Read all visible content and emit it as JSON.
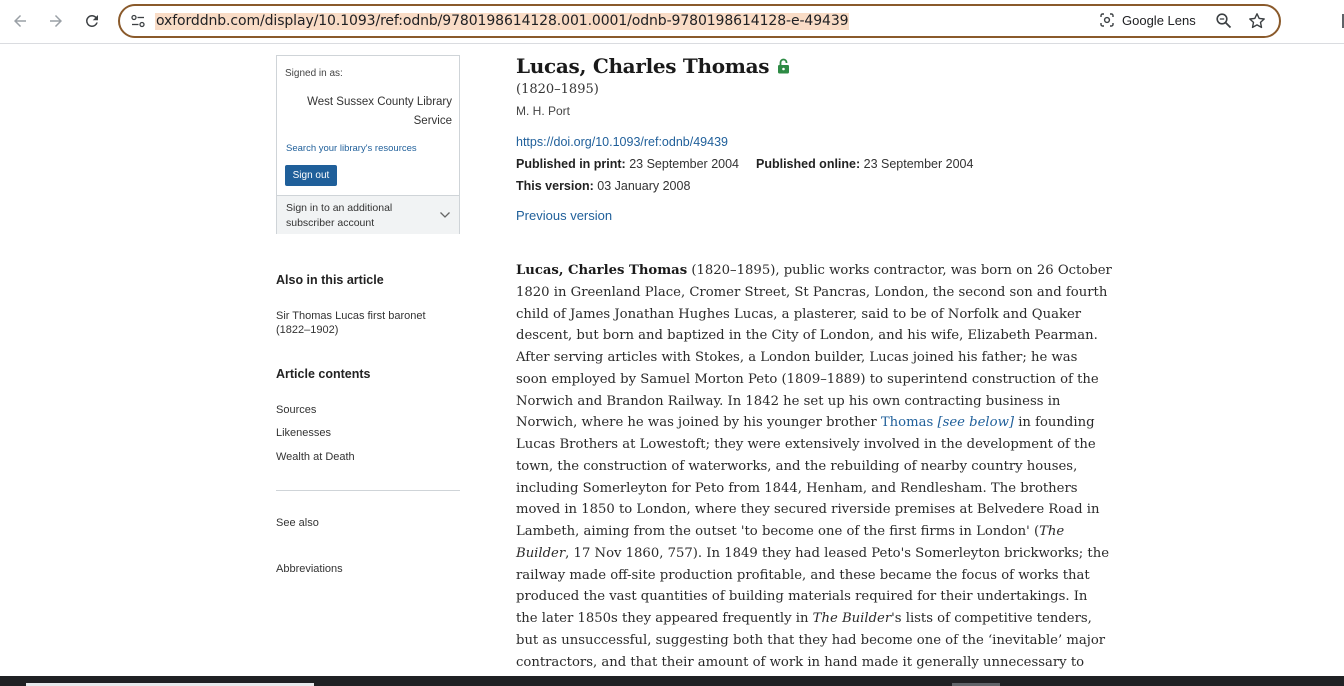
{
  "browser": {
    "url": "oxforddnb.com/display/10.1093/ref:odnb/9780198614128.001.0001/odnb-9780198614128-e-49439",
    "lens_label": "Google Lens",
    "icons": [
      "back-arrow-icon",
      "forward-arrow-icon",
      "reload-icon",
      "site-info-icon",
      "google-lens-icon",
      "zoom-icon",
      "star-icon"
    ],
    "accent_color": "#8a5a2b",
    "url_highlight": "#f9dcc6"
  },
  "sidebar": {
    "signed_in_label": "Signed in as:",
    "institution": "West Sussex County Library Service",
    "library_link": "Search your library's resources",
    "sign_out": "Sign out",
    "additional_account": "Sign in to an additional subscriber account",
    "also_heading": "Also in this article",
    "also_item": "Sir Thomas Lucas first baronet (1822–1902)",
    "contents_heading": "Article contents",
    "contents": [
      "Sources",
      "Likenesses",
      "Wealth at Death"
    ],
    "see_also": "See also",
    "abbreviations": "Abbreviations"
  },
  "article": {
    "title": "Lucas, Charles Thomas",
    "dates": "(1820–1895)",
    "author": "M. H. Port",
    "doi": "https://doi.org/10.1093/ref:odnb/49439",
    "published_print_label": "Published in print:",
    "published_print": "23 September 2004",
    "published_online_label": "Published online:",
    "published_online": "23 September 2004",
    "this_version_label": "This version:",
    "this_version": "03 January 2008",
    "previous_version": "Previous version",
    "body": {
      "lead_name": "Lucas, Charles Thomas",
      "l1": " (1820–1895), public works contractor, was born on 26 October",
      "l2": "1820 in Greenland Place, Cromer Street, St Pancras, London, the second son and fourth",
      "l3": "child of James Jonathan Hughes Lucas, a plasterer, said to be of Norfolk and Quaker",
      "l4": "descent, but born and baptized in the City of London, and his wife, Elizabeth Pearman.",
      "l5": "After serving articles with Stokes, a London builder, Lucas joined his father; he was",
      "l6": "soon employed by Samuel Morton Peto (1809–1889) to superintend construction of the",
      "l7": "Norwich and Brandon Railway. In 1842 he set up his own contracting business in",
      "l8a": "Norwich, where he was joined by his younger brother ",
      "l8_link": "Thomas",
      "l8_see": "[see below]",
      "l8b": " in founding",
      "l9": "Lucas Brothers at Lowestoft; they were extensively involved in the development of the",
      "l10": "town, the construction of waterworks, and the rebuilding of nearby country houses,",
      "l11": "including Somerleyton for Peto from 1844, Henham, and Rendlesham. The brothers",
      "l12": "moved in 1850 to London, where they secured riverside premises at Belvedere Road in",
      "l13a": "Lambeth, aiming from the outset 'to become one of the first firms in London' (",
      "l13_ital": "The",
      "l14_ital": "Builder",
      "l14b": ", 17 Nov 1860, 757). In 1849 they had leased Peto's Somerleyton brickworks; the",
      "l15": "railway made off-site production profitable, and these became the focus of works that",
      "l16": "produced the vast quantities of building materials required for their undertakings. In",
      "l17a": "the later 1850s they appeared frequently in ",
      "l17_ital": "The Builder",
      "l17b": "'s lists of competitive tenders,",
      "l18": "but as unsuccessful, suggesting both that they had become one of the ‘inevitable’ major",
      "l19": "contractors, and that their amount of work in hand made it generally unnecessary to"
    }
  },
  "link_color": "#1f5f9a"
}
